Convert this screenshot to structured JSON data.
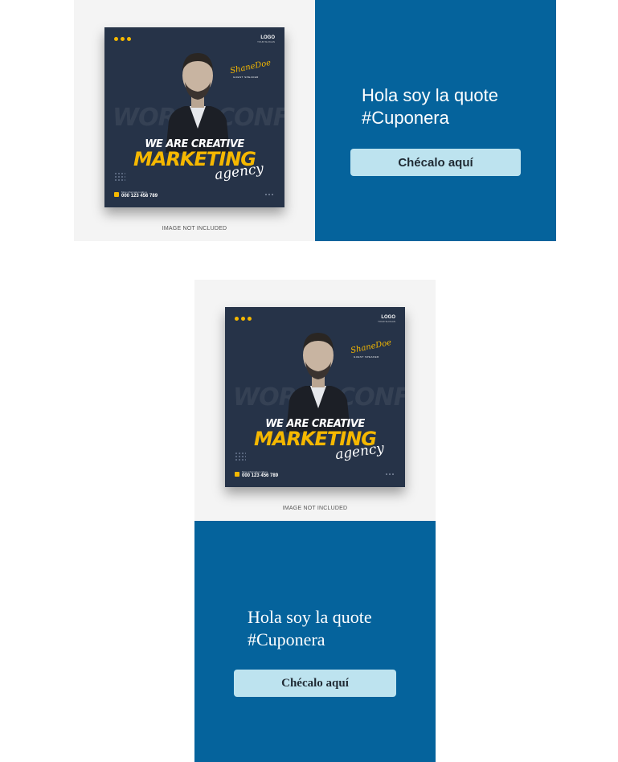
{
  "colors": {
    "panel_blue": "#05639c",
    "button_bg": "#bde3ef",
    "accent_yellow": "#f5b800",
    "poster_bg": "#263348"
  },
  "cards": [
    {
      "layout": "horizontal",
      "image": {
        "poster_logo": "LOGO",
        "poster_logo_sub": "YOUR SLOGAN",
        "signature": "ShaneDoe",
        "signature_sub": "GUEST SPEAKER",
        "background_text": "WORLD CONFERENCE",
        "headline_1": "WE ARE CREATIVE",
        "headline_2": "MARKETING",
        "headline_3": "agency",
        "info_label": "More information call us",
        "phone": "000 123 456 789",
        "caption": "IMAGE NOT INCLUDED"
      },
      "quote": "Hola soy la quote #Cuponera",
      "button_label": "Chécalo aquí",
      "font": "sans"
    },
    {
      "layout": "vertical",
      "image": {
        "poster_logo": "LOGO",
        "poster_logo_sub": "YOUR SLOGAN",
        "signature": "ShaneDoe",
        "signature_sub": "GUEST SPEAKER",
        "background_text": "WORLD CONFERENCE",
        "headline_1": "WE ARE CREATIVE",
        "headline_2": "MARKETING",
        "headline_3": "agency",
        "info_label": "More information call us",
        "phone": "000 123 456 789",
        "caption": "IMAGE NOT INCLUDED"
      },
      "quote": "Hola soy la quote #Cuponera",
      "button_label": "Chécalo aquí",
      "font": "serif"
    }
  ]
}
